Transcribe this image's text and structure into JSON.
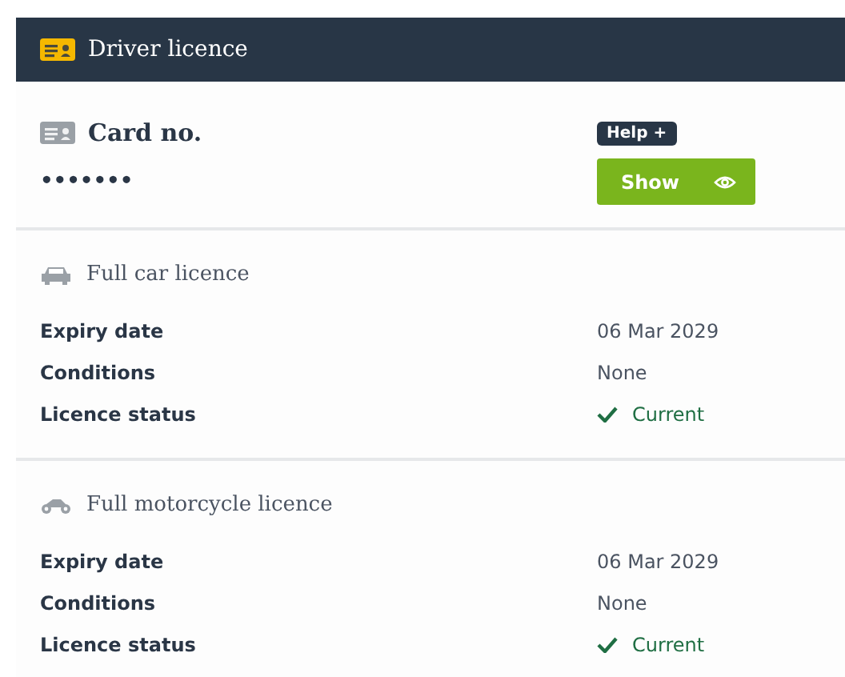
{
  "header": {
    "title": "Driver licence"
  },
  "card": {
    "label": "Card no.",
    "help": "Help +",
    "masked_value": "•••••••",
    "show_button": "Show"
  },
  "licences": [
    {
      "kind": "car",
      "title": "Full car licence",
      "rows": [
        {
          "label": "Expiry date",
          "value": "06 Mar 2029"
        },
        {
          "label": "Conditions",
          "value": "None"
        },
        {
          "label": "Licence status",
          "value": "Current",
          "kind": "status"
        }
      ]
    },
    {
      "kind": "motorcycle",
      "title": "Full motorcycle licence",
      "rows": [
        {
          "label": "Expiry date",
          "value": "06 Mar 2029"
        },
        {
          "label": "Conditions",
          "value": "None"
        },
        {
          "label": "Licence status",
          "value": "Current",
          "kind": "status"
        }
      ]
    }
  ]
}
